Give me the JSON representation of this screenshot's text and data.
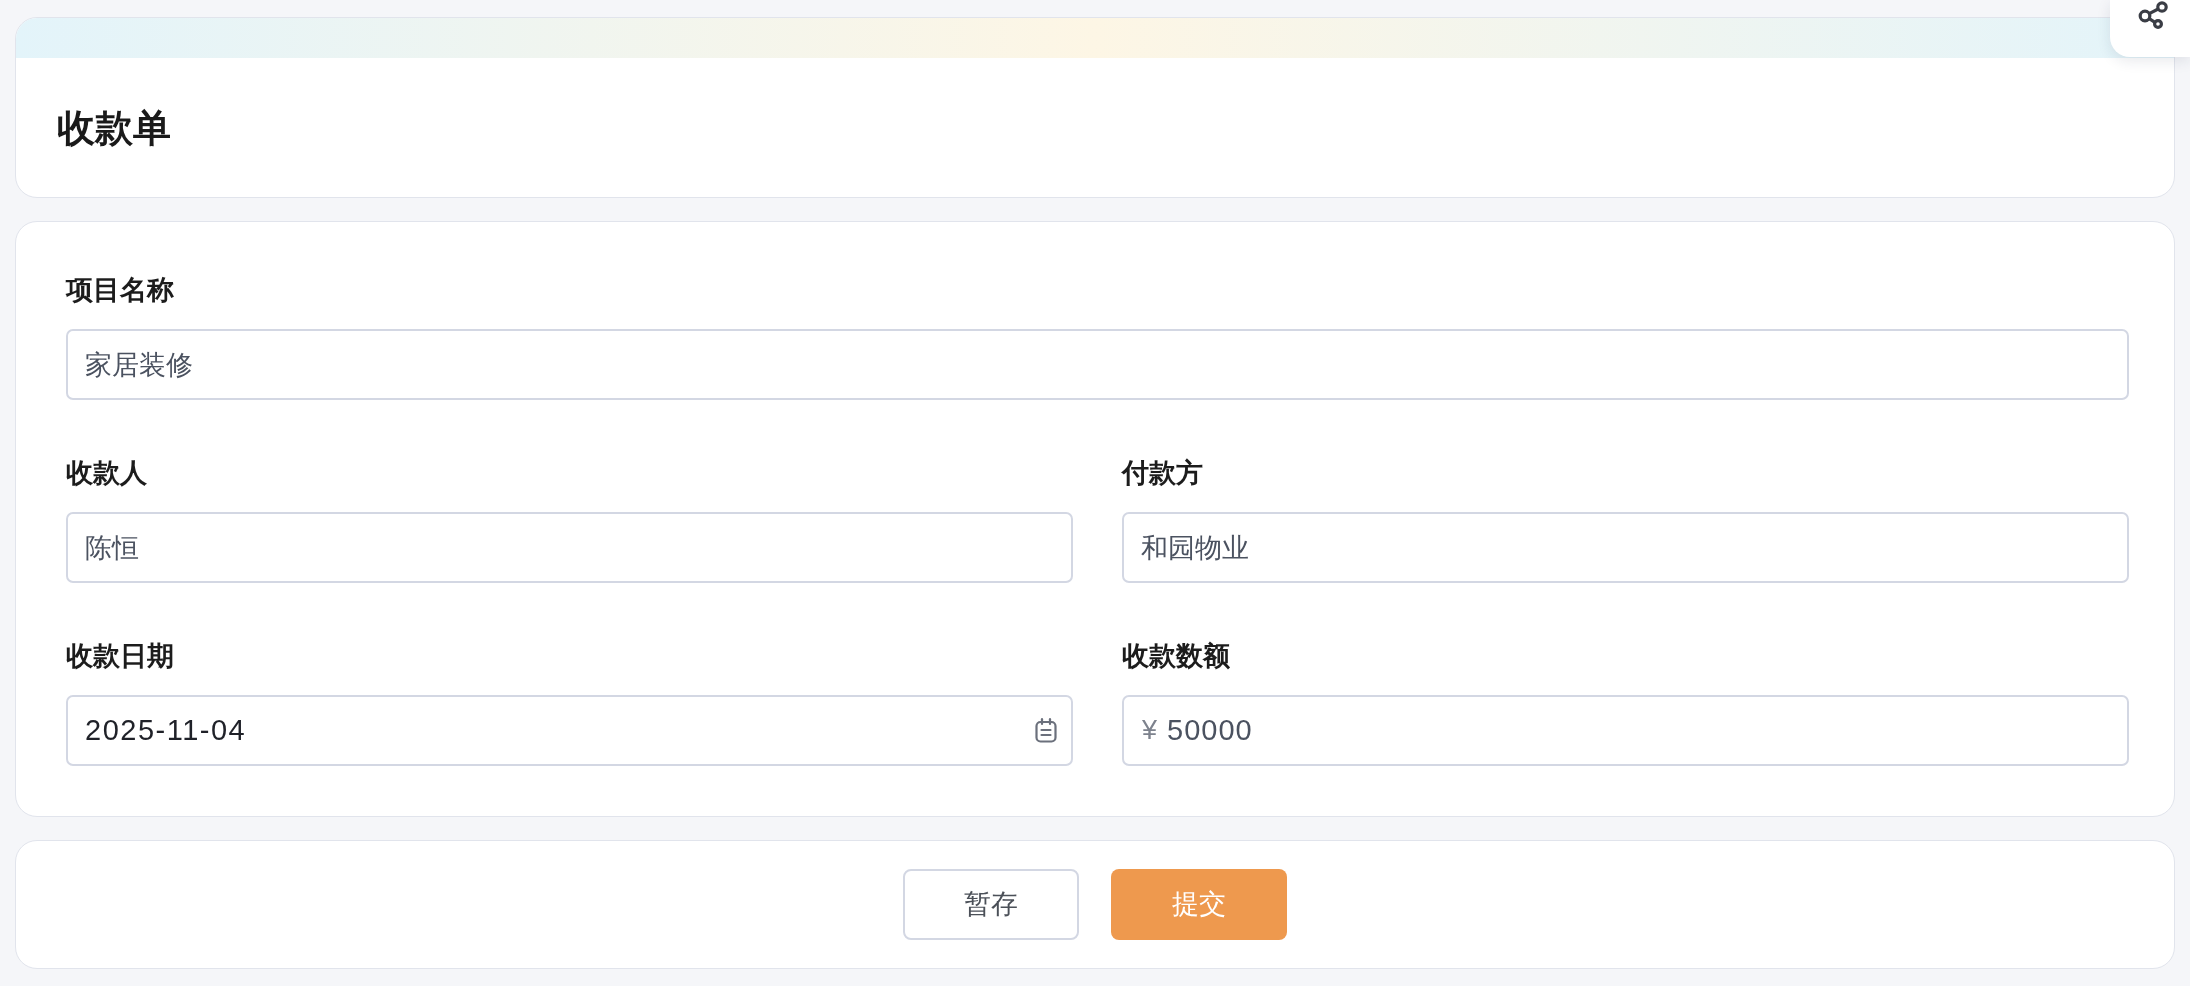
{
  "header": {
    "title": "收款单"
  },
  "form": {
    "rows": [
      {
        "fields": [
          {
            "kind": "text",
            "label": "项目名称",
            "value": "家居装修"
          }
        ]
      },
      {
        "fields": [
          {
            "kind": "text",
            "label": "收款人",
            "value": "陈恒"
          },
          {
            "kind": "text",
            "label": "付款方",
            "value": "和园物业"
          }
        ]
      },
      {
        "fields": [
          {
            "kind": "date",
            "label": "收款日期",
            "value": "2025-11-04"
          },
          {
            "kind": "currency",
            "label": "收款数额",
            "prefix": "¥",
            "value": "50000"
          }
        ]
      }
    ]
  },
  "actions": {
    "buttons": [
      {
        "kind": "secondary",
        "label": "暂存"
      },
      {
        "kind": "primary",
        "label": "提交"
      }
    ]
  }
}
